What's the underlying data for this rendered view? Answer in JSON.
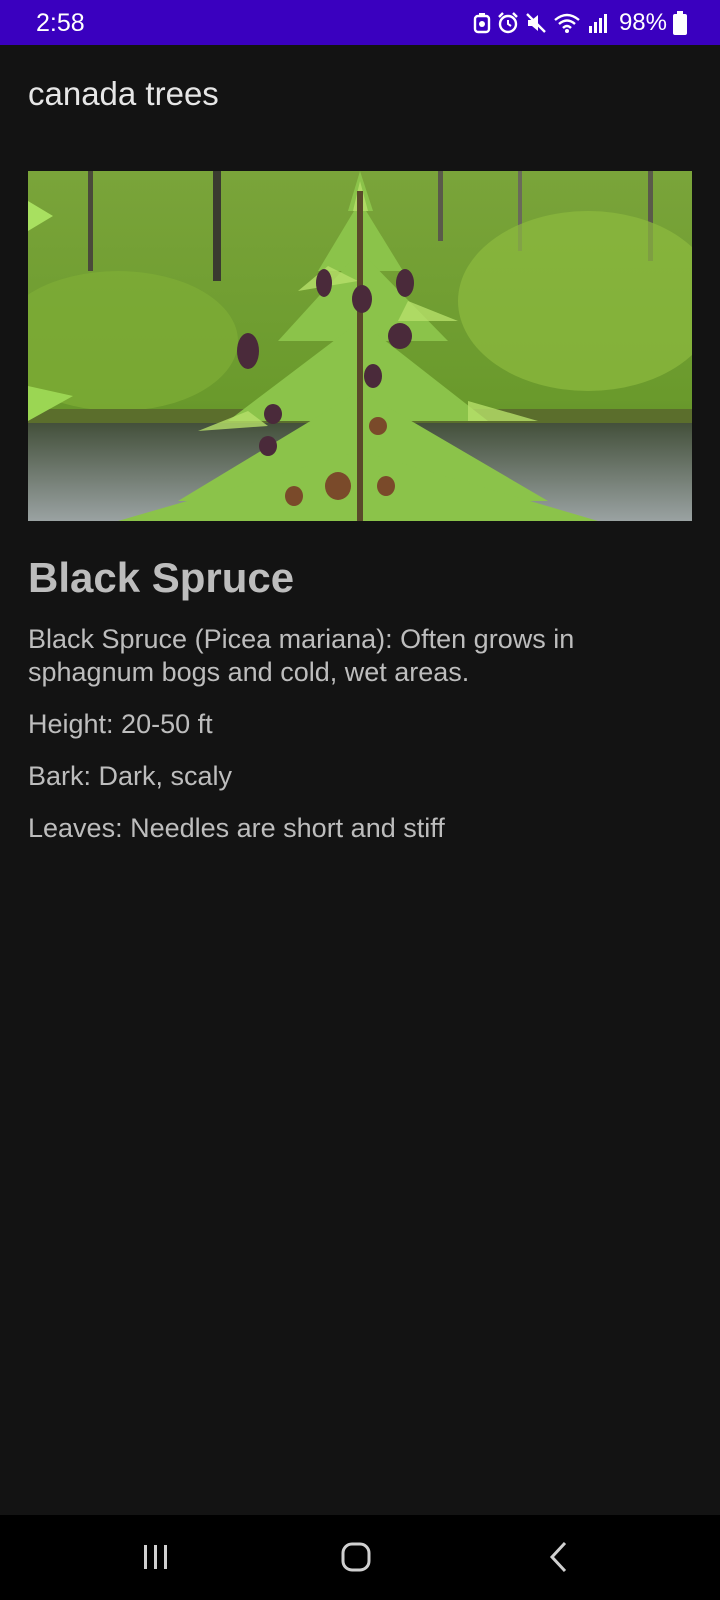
{
  "status_bar": {
    "time": "2:58",
    "battery": "98%",
    "icons": [
      "notification-icon",
      "alarm-icon",
      "mute-icon",
      "wifi-icon",
      "signal-icon",
      "battery-icon"
    ],
    "background": "#3a00bf"
  },
  "app_bar": {
    "title": "canada trees"
  },
  "tree": {
    "image_subject": "black spruce tree with cones by a bog pond",
    "name": "Black Spruce",
    "description": "Black Spruce (Picea mariana): Often grows in sphagnum bogs and cold, wet areas.",
    "height": "Height: 20-50 ft",
    "bark": "Bark: Dark, scaly",
    "leaves": "Leaves: Needles are short and stiff"
  },
  "nav_bar": {
    "buttons": [
      "recents-icon",
      "home-icon",
      "back-icon"
    ]
  },
  "colors": {
    "page_background": "#131313",
    "text": "#bdbdbd"
  }
}
